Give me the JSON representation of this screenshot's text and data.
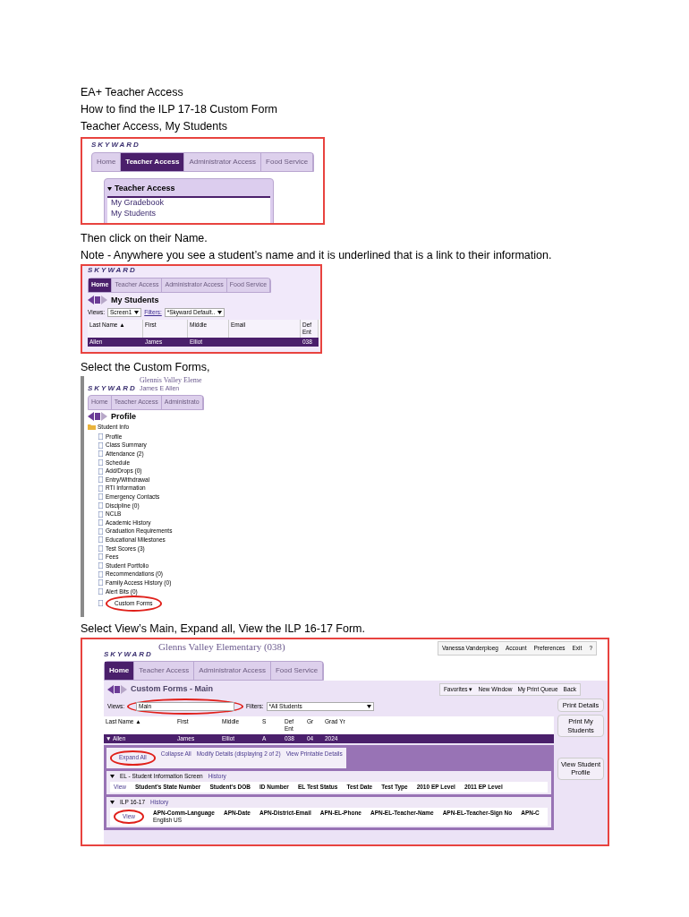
{
  "heading": [
    "EA+ Teacher Access",
    "How to find the ILP 17-18 Custom Form",
    "Teacher Access, My Students"
  ],
  "shot1": {
    "logo": "SKYWARD",
    "tabs": [
      {
        "label": "Home",
        "selected": false
      },
      {
        "label": "Teacher Access",
        "selected": true
      },
      {
        "label": "Administrator Access",
        "selected": false
      },
      {
        "label": "Food Service",
        "selected": false
      }
    ],
    "panel_title": "Teacher Access",
    "items": [
      "My Gradebook",
      "My Students"
    ]
  },
  "text2": [
    "Then click on their Name.",
    "Note - Anywhere you see a student’s name and it is underlined that is a link to their information."
  ],
  "shot2": {
    "logo": "SKYWARD",
    "tabs": [
      {
        "label": "Home",
        "selected": true
      },
      {
        "label": "Teacher Access",
        "selected": false
      },
      {
        "label": "Administrator Access",
        "selected": false
      },
      {
        "label": "Food Service",
        "selected": false
      }
    ],
    "title": "My Students",
    "views_label": "Views:",
    "views_value": "Screen1",
    "filters_label": "Filters:",
    "filters_value": "*Skyward Default..",
    "columns": [
      "Last Name ▲",
      "First",
      "Middle",
      "Email",
      "Def Ent"
    ],
    "rows": [
      {
        "cells": [
          "Allen",
          "James",
          "Elliot",
          "",
          "038"
        ],
        "selected": true
      }
    ]
  },
  "text3": "Select the Custom Forms,",
  "shot3": {
    "logo": "SKYWARD",
    "school": "Glennis Valley Eleme",
    "user": "James E Allen",
    "tabs": [
      {
        "label": "Home",
        "selected": false
      },
      {
        "label": "Teacher Access",
        "selected": false
      },
      {
        "label": "Administrato",
        "selected": false
      }
    ],
    "title": "Profile",
    "tree": {
      "label": "Student Info",
      "children": [
        {
          "label": "Profile",
          "circled": false
        },
        {
          "label": "Class Summary",
          "circled": false
        },
        {
          "label": "Attendance (2)",
          "circled": false
        },
        {
          "label": "Schedule",
          "circled": false
        },
        {
          "label": "Add/Drops (0)",
          "circled": false
        },
        {
          "label": "Entry/Withdrawal",
          "circled": false
        },
        {
          "label": "RTI Information",
          "circled": false
        },
        {
          "label": "Emergency Contacts",
          "circled": false
        },
        {
          "label": "Discipline (0)",
          "circled": false
        },
        {
          "label": "NCLB",
          "circled": false
        },
        {
          "label": "Academic History",
          "circled": false
        },
        {
          "label": "Graduation Requirements",
          "circled": false
        },
        {
          "label": "Educational Milestones",
          "circled": false
        },
        {
          "label": "Test Scores (3)",
          "circled": false
        },
        {
          "label": "Fees",
          "circled": false
        },
        {
          "label": "Student Portfolio",
          "circled": false
        },
        {
          "label": "Recommendations (0)",
          "circled": false
        },
        {
          "label": "Family Access History (0)",
          "circled": false
        },
        {
          "label": "Alert Bits (0)",
          "circled": false
        },
        {
          "label": "Custom Forms",
          "circled": true
        }
      ]
    }
  },
  "text4": "Select View’s Main, Expand all, View the ILP 16-17 Form.",
  "shot4": {
    "logo": "SKYWARD",
    "school": "Glenns Valley Elementary (038)",
    "user_links": [
      "Vanessa Vanderploeg",
      "Account",
      "Preferences",
      "Exit",
      "?"
    ],
    "tabs": [
      {
        "label": "Home",
        "selected": true
      },
      {
        "label": "Teacher Access",
        "selected": false
      },
      {
        "label": "Administrator Access",
        "selected": false
      },
      {
        "label": "Food Service",
        "selected": false
      }
    ],
    "title": "Custom Forms - Main",
    "toolbar": [
      "Favorites ▾",
      "New Window",
      "My Print Queue",
      "Back"
    ],
    "views_label": "Views:",
    "views_value": "Main",
    "views_circled": true,
    "filters_label": "Filters:",
    "filters_value": "*All Students",
    "columns": [
      "Last Name ▲",
      "First",
      "Middle",
      "S",
      "Def Ent",
      "Gr",
      "Grad Yr"
    ],
    "student": [
      "▼ Allen",
      "James",
      "Elliot",
      "A",
      "038",
      "04",
      "2024"
    ],
    "actions": [
      {
        "label": "Expand All",
        "circled": true
      },
      {
        "label": "Collapse All",
        "circled": false
      },
      {
        "label": "Modify Details (displaying 2 of 2)",
        "circled": false
      },
      {
        "label": "View Printable Details",
        "circled": false
      }
    ],
    "sections": [
      {
        "title": "EL - Student Information Screen",
        "link": "History",
        "view": "View",
        "view_circled": false,
        "columns": [
          "Student's State Number",
          "Student's DOB",
          "ID Number",
          "EL Test Status",
          "Test Date",
          "Test Type",
          "2010 EP Level",
          "2011 EP Level"
        ]
      },
      {
        "title": "ILP 16-17",
        "link": "History",
        "view": "View",
        "view_circled": true,
        "columns": [
          "APN-Comm-Language",
          "APN-Date",
          "APN-District-Email",
          "APN-EL-Phone",
          "APN-EL-Teacher-Name",
          "APN-EL-Teacher-Sign No",
          "APN-C"
        ],
        "values": [
          "English US"
        ]
      }
    ],
    "side_buttons": [
      "Print Details",
      "Print My Students",
      "View Student Profile"
    ]
  }
}
